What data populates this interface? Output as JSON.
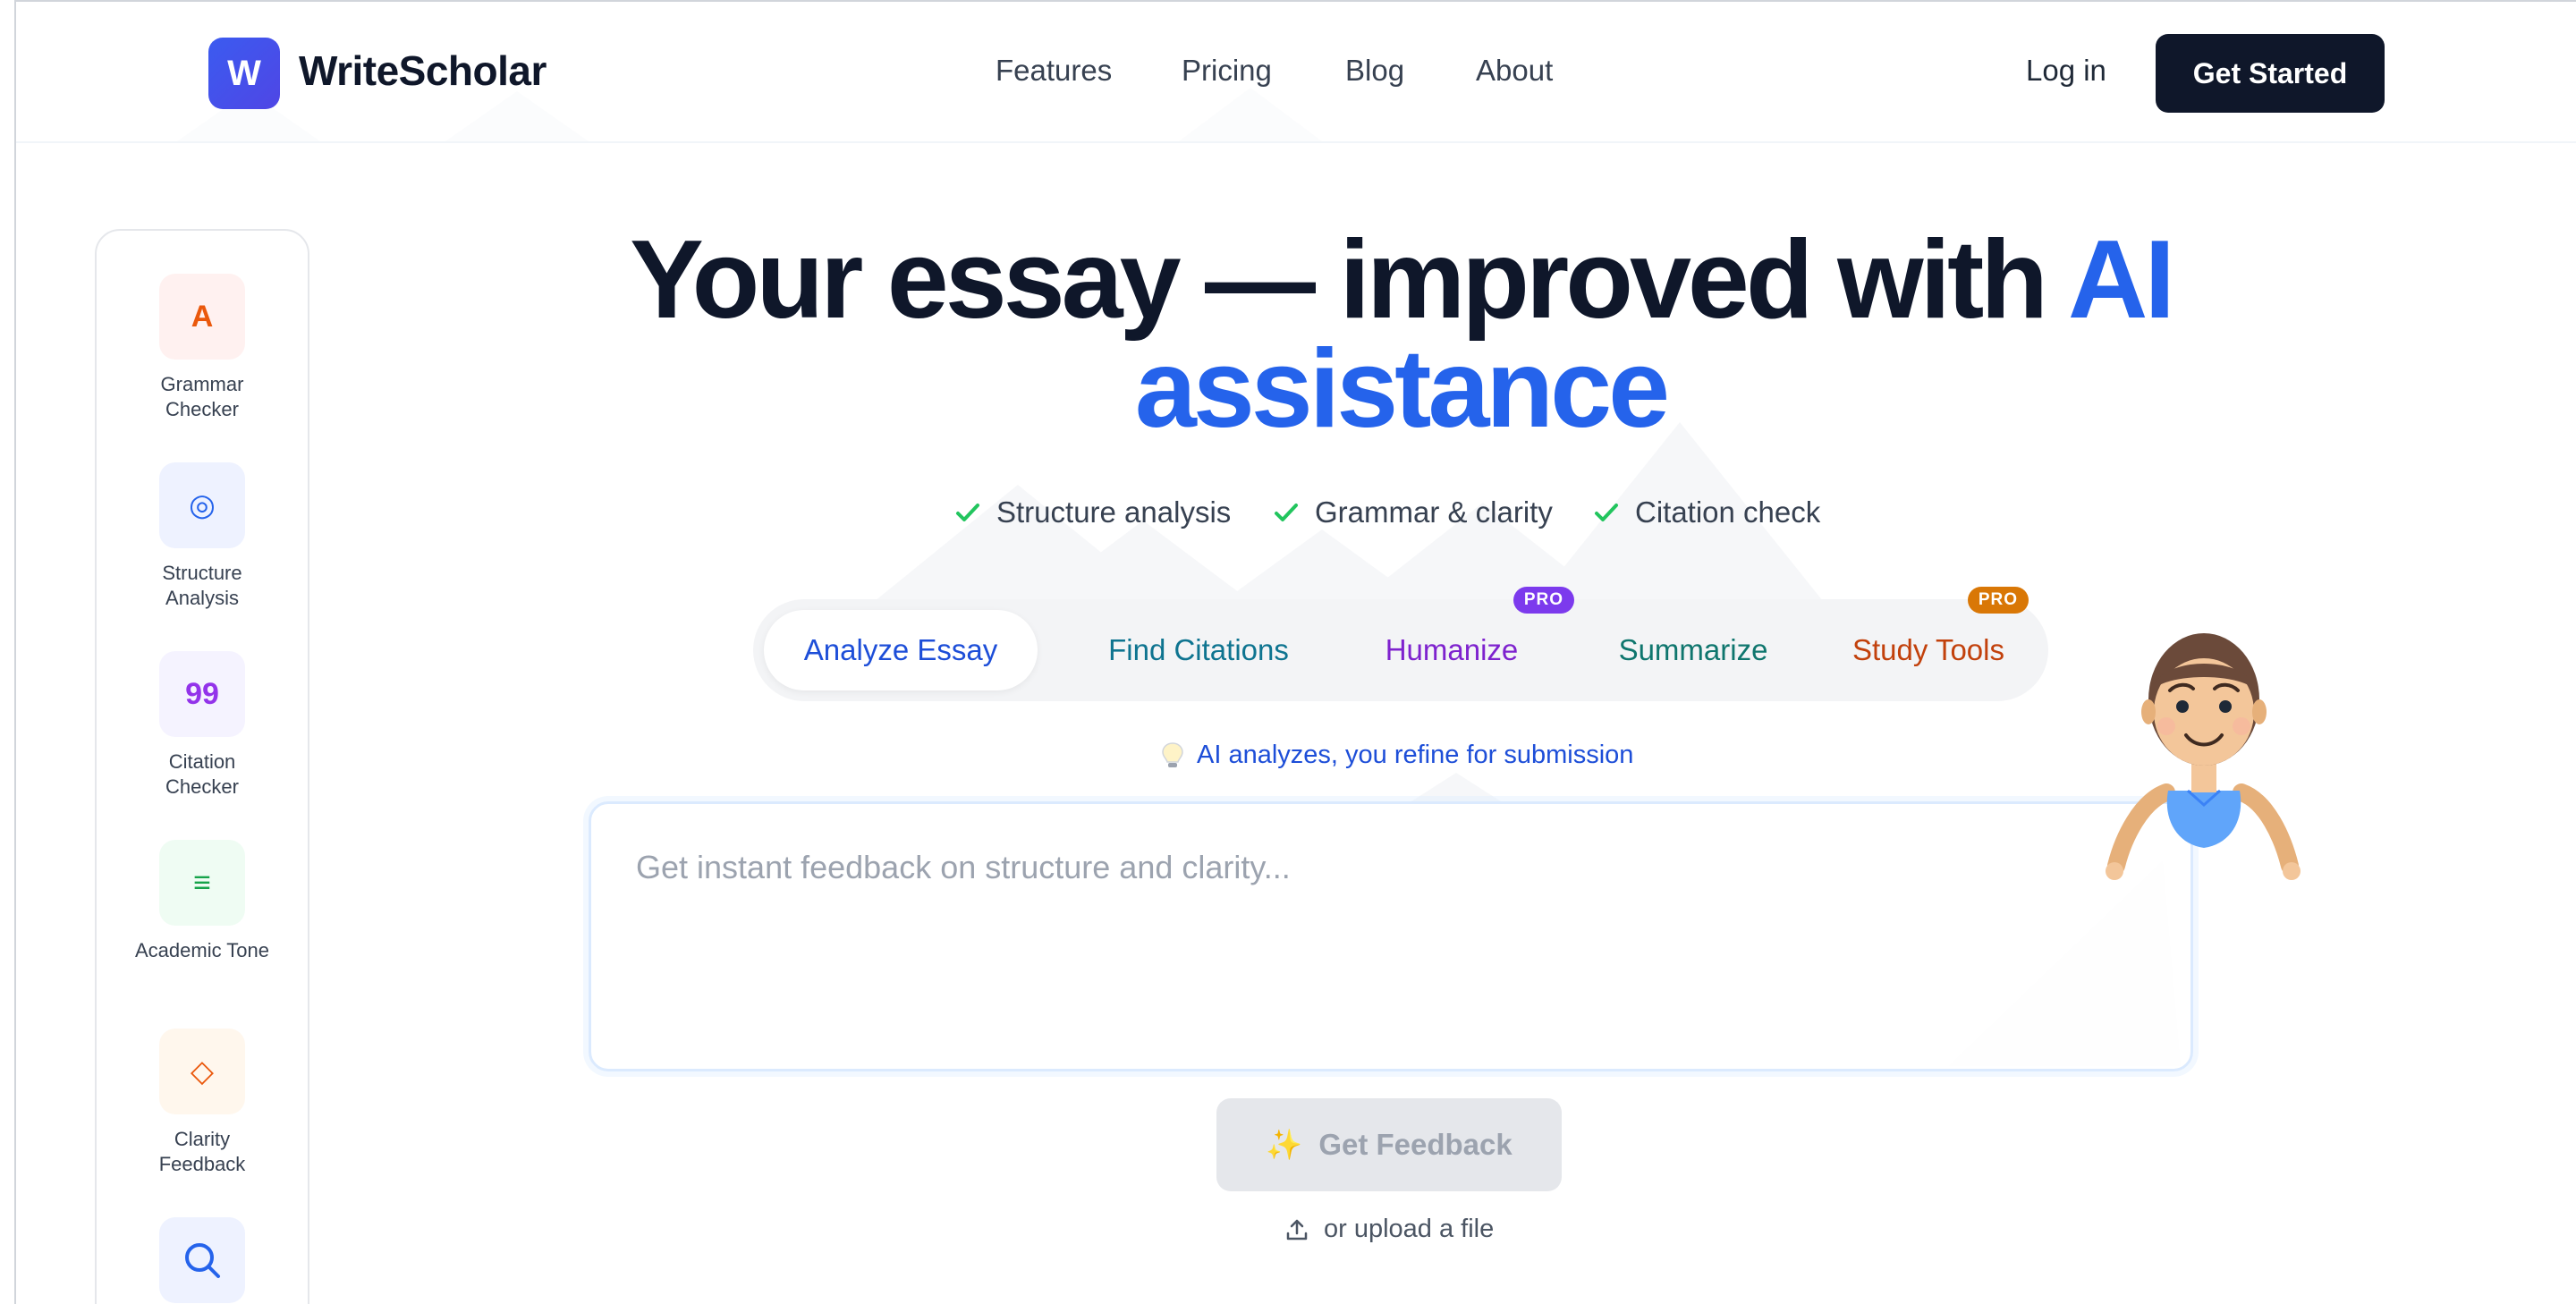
{
  "header": {
    "logo_letter": "W",
    "brand": "WriteScholar",
    "nav": [
      "Features",
      "Pricing",
      "Blog",
      "About"
    ],
    "login": "Log in",
    "cta": "Get Started"
  },
  "sidebar": {
    "tools": [
      {
        "glyph": "A",
        "label": "Grammar Checker",
        "icon": "grammar-icon",
        "color": "#ea580c",
        "bg": "#fff1f0"
      },
      {
        "glyph": "◎",
        "label": "Structure Analysis",
        "icon": "target-icon",
        "color": "#2563eb",
        "bg": "#eef2ff"
      },
      {
        "glyph": "99",
        "label": "Citation Checker",
        "icon": "quote-icon",
        "color": "#9333ea",
        "bg": "#f5f3ff"
      },
      {
        "glyph": "≡",
        "label": "Academic Tone",
        "icon": "lines-icon",
        "color": "#16a34a",
        "bg": "#effcf3"
      },
      {
        "glyph": "◇",
        "label": "Clarity Feedback",
        "icon": "diamond-icon",
        "color": "#ea580c",
        "bg": "#fff7ed"
      },
      {
        "glyph": "",
        "label": "",
        "icon": "search-icon",
        "color": "#2563eb",
        "bg": "#eef2ff"
      }
    ]
  },
  "hero": {
    "title_main": "Your essay — improved with",
    "title_accent": "AI assistance"
  },
  "features": [
    "Structure analysis",
    "Grammar & clarity",
    "Citation check"
  ],
  "tabs": [
    {
      "label": "Analyze Essay",
      "color": "#1d4ed8",
      "active": true,
      "badge": ""
    },
    {
      "label": "Find Citations",
      "color": "#0e7490",
      "active": false,
      "badge": ""
    },
    {
      "label": "Humanize",
      "color": "#7e22ce",
      "active": false,
      "badge": "PRO"
    },
    {
      "label": "Summarize",
      "color": "#0f766e",
      "active": false,
      "badge": ""
    },
    {
      "label": "Study Tools",
      "color": "#c2410c",
      "active": false,
      "badge": "PRO"
    }
  ],
  "hint": {
    "text": "AI analyzes, you refine for submission",
    "icon": "lightbulb-icon"
  },
  "editor": {
    "placeholder": "Get instant feedback on structure and clarity...",
    "value": ""
  },
  "feedback_button": {
    "label": "Get Feedback",
    "icon": "sparkles-icon"
  },
  "upload": {
    "label": "or upload a file",
    "icon": "upload-icon"
  },
  "colors": {
    "accent": "#2563eb",
    "brand": "#3b5bf0",
    "dark": "#0f172a",
    "check": "#22c55e"
  }
}
